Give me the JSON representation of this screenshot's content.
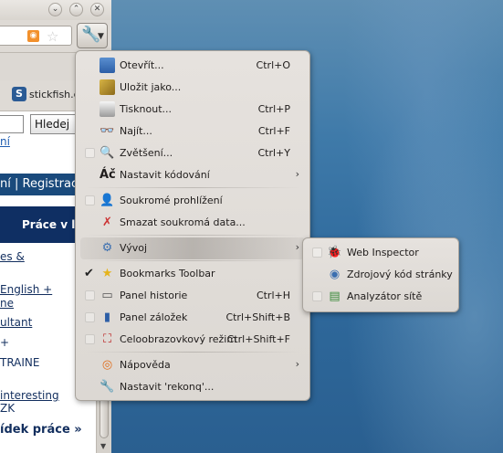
{
  "browser": {
    "window_buttons": [
      "⌄",
      "⌃",
      "✕"
    ],
    "bookmark_site": "stickfish.c",
    "page": {
      "search_button": "Hledej",
      "top_link": "ní",
      "nav_text": "ní | Registrac",
      "banner": "Práce v l",
      "links": [
        "es &",
        "English +",
        "ne",
        "ultant",
        "+",
        "TRAINE",
        "interesting",
        "ZK",
        "ídek práce »"
      ]
    }
  },
  "menu": {
    "items": [
      {
        "label": "Otevřít...",
        "shortcut": "Ctrl+O",
        "icon": "open-icon"
      },
      {
        "label": "Uložit jako...",
        "shortcut": "",
        "icon": "save-as-icon"
      },
      {
        "label": "Tisknout...",
        "shortcut": "Ctrl+P",
        "icon": "print-icon"
      },
      {
        "label": "Najít...",
        "shortcut": "Ctrl+F",
        "icon": "binoculars-icon"
      },
      {
        "label": "Zvětšení...",
        "shortcut": "Ctrl+Y",
        "icon": "zoom-icon"
      },
      {
        "label": "Nastavit kódování",
        "shortcut": "",
        "icon": "encoding-icon"
      },
      {
        "label": "Soukromé prohlížení",
        "shortcut": "",
        "icon": "private-user-icon"
      },
      {
        "label": "Smazat soukromá data...",
        "shortcut": "",
        "icon": "clear-data-icon"
      },
      {
        "label": "Vývoj",
        "shortcut": "",
        "icon": "development-icon"
      },
      {
        "label": "Bookmarks Toolbar",
        "shortcut": "",
        "icon": "star-icon"
      },
      {
        "label": "Panel historie",
        "shortcut": "Ctrl+H",
        "icon": "history-icon"
      },
      {
        "label": "Panel záložek",
        "shortcut": "Ctrl+Shift+B",
        "icon": "bookmarks-icon"
      },
      {
        "label": "Celoobrazovkový režim",
        "shortcut": "Ctrl+Shift+F",
        "icon": "fullscreen-icon"
      },
      {
        "label": "Nápověda",
        "shortcut": "",
        "icon": "help-icon"
      },
      {
        "label": "Nastavit 'rekonq'...",
        "shortcut": "",
        "icon": "configure-icon"
      }
    ]
  },
  "submenu": {
    "items": [
      {
        "label": "Web Inspector",
        "icon": "bug-icon"
      },
      {
        "label": "Zdrojový kód stránky",
        "icon": "source-icon"
      },
      {
        "label": "Analyzátor sítě",
        "icon": "network-icon"
      }
    ]
  }
}
